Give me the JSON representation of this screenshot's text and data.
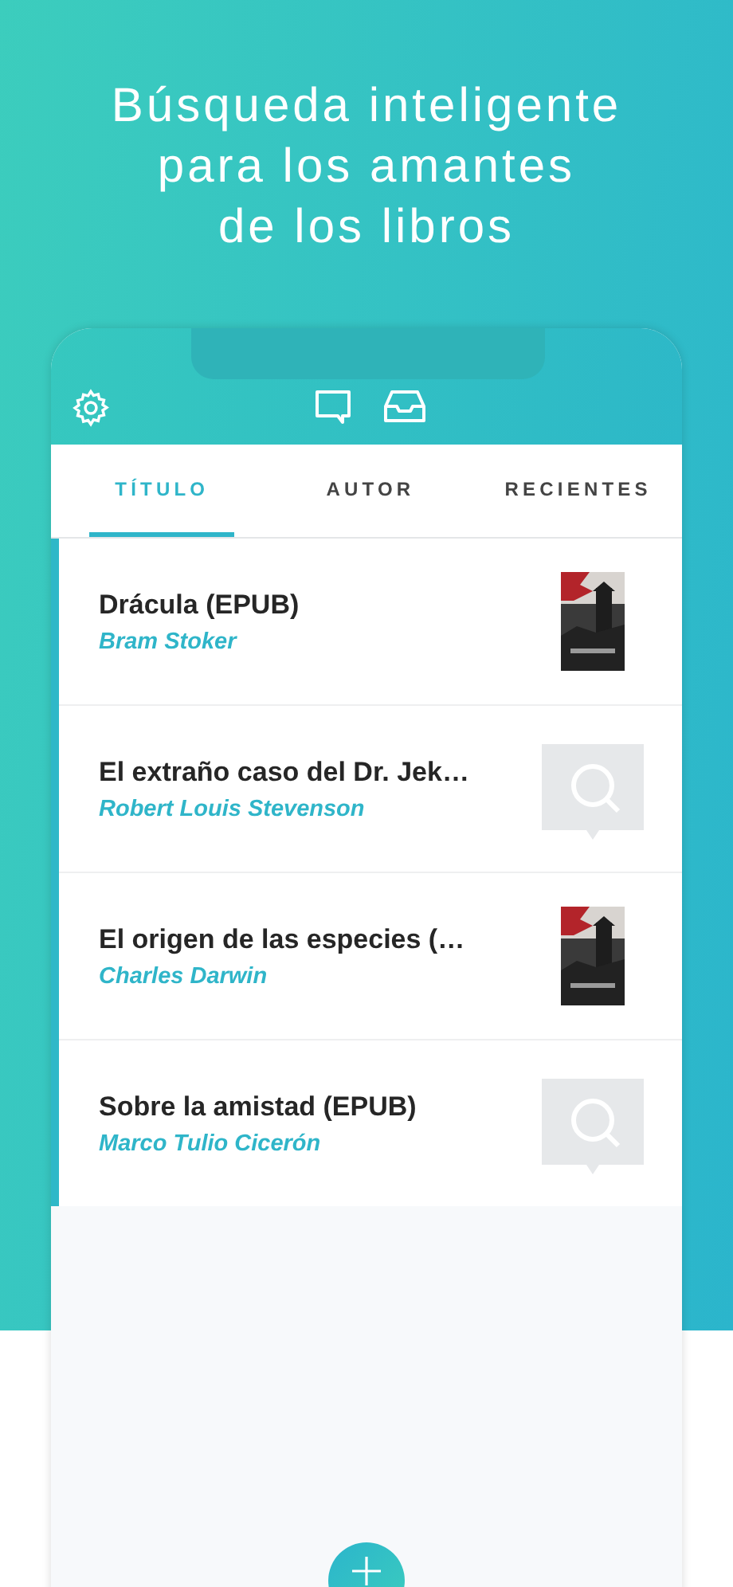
{
  "headline": [
    "Búsqueda inteligente",
    "para los amantes",
    "de los libros"
  ],
  "tabs": [
    {
      "label": "TÍTULO",
      "selected": true
    },
    {
      "label": "AUTOR",
      "selected": false
    },
    {
      "label": "RECIENTES",
      "selected": false
    }
  ],
  "books": [
    {
      "title": "Drácula (EPUB)",
      "author": "Bram Stoker",
      "kind": "picture"
    },
    {
      "title": "El extraño caso del Dr. Jek…",
      "author": "Robert Louis Stevenson",
      "kind": "placeholder"
    },
    {
      "title": "El origen de las especies (…",
      "author": "Charles Darwin",
      "kind": "picture"
    },
    {
      "title": "Sobre la amistad (EPUB)",
      "author": "Marco Tulio Cicerón",
      "kind": "placeholder"
    }
  ]
}
